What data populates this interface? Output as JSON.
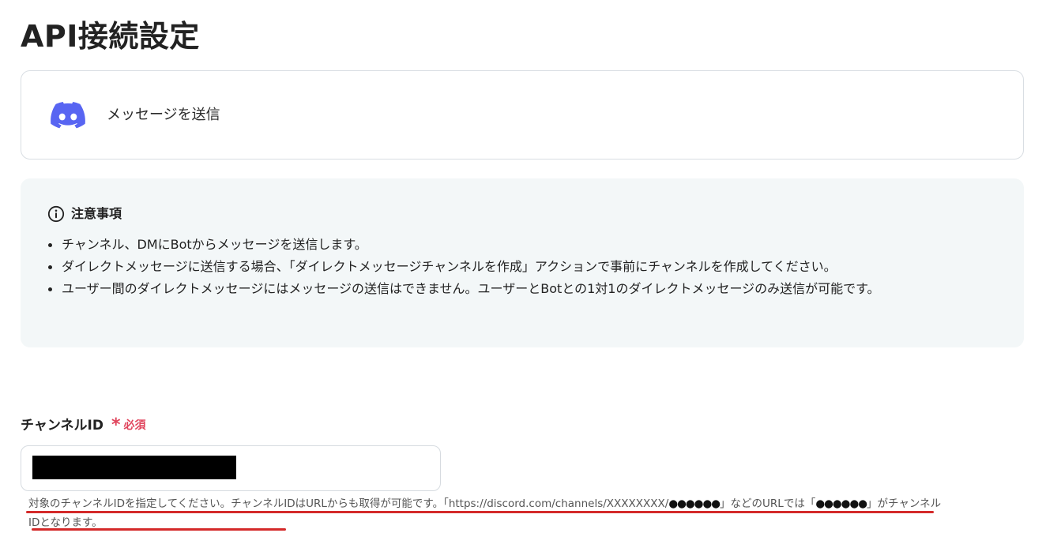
{
  "page": {
    "title": "API接続設定"
  },
  "action": {
    "icon": "discord-icon",
    "label": "メッセージを送信",
    "brand_color": "#5865F2"
  },
  "notice": {
    "icon": "info-icon",
    "title": "注意事項",
    "items": [
      "チャンネル、DMにBotからメッセージを送信します。",
      "ダイレクトメッセージに送信する場合、「ダイレクトメッセージチャンネルを作成」アクションで事前にチャンネルを作成してください。",
      "ユーザー間のダイレクトメッセージにはメッセージの送信はできません。ユーザーとBotとの1対1のダイレクトメッセージのみ送信が可能です。"
    ]
  },
  "field": {
    "label": "チャンネルID",
    "required_mark": "*",
    "required_label": "必須",
    "required_color": "#E0445C",
    "value": "",
    "help_part1": "対象のチャンネルIDを指定してください。チャンネルIDはURLからも取得が可能です。「https://discord.com/channels/XXXXXXXX/",
    "help_mask1": "●●●●●●",
    "help_part2": "」などのURLでは「",
    "help_mask2": "●●●●●●",
    "help_part3": "」がチャンネルIDとなります。",
    "underline_color": "#D42A2A"
  }
}
